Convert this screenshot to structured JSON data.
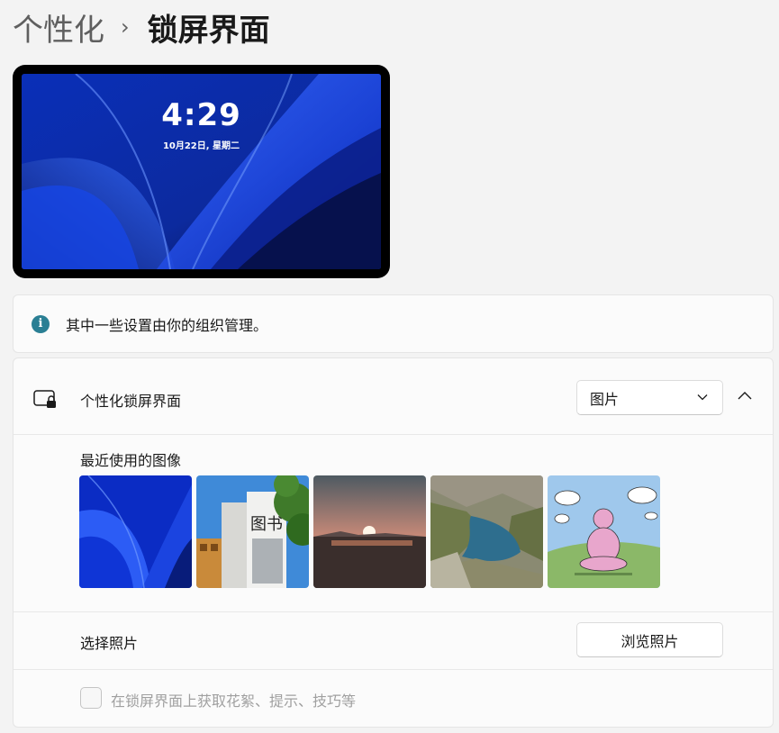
{
  "breadcrumb": {
    "parent": "个性化",
    "separator": "›",
    "current": "锁屏界面"
  },
  "preview": {
    "time": "4:29",
    "date": "10月22日, 星期二"
  },
  "info": {
    "icon": "info-icon",
    "text": "其中一些设置由你的组织管理。"
  },
  "personalize": {
    "icon": "lock-screen-icon",
    "title": "个性化锁屏界面",
    "dropdown_value": "图片",
    "dropdown_icon": "chevron-down-icon",
    "expand_icon": "chevron-up-icon"
  },
  "recent": {
    "label": "最近使用的图像",
    "images": [
      {
        "name": "windows-bloom-blue"
      },
      {
        "name": "library-building-trees"
      },
      {
        "name": "sunset-over-water"
      },
      {
        "name": "mountain-lake-reservoir"
      },
      {
        "name": "pink-character-meditating"
      }
    ]
  },
  "choose": {
    "label": "选择照片",
    "button": "浏览照片"
  },
  "tips": {
    "label": "在锁屏界面上获取花絮、提示、技巧等",
    "checked": false
  },
  "colors": {
    "accent": "#2a7f94",
    "bloom_blue": "#1a3fd8"
  }
}
